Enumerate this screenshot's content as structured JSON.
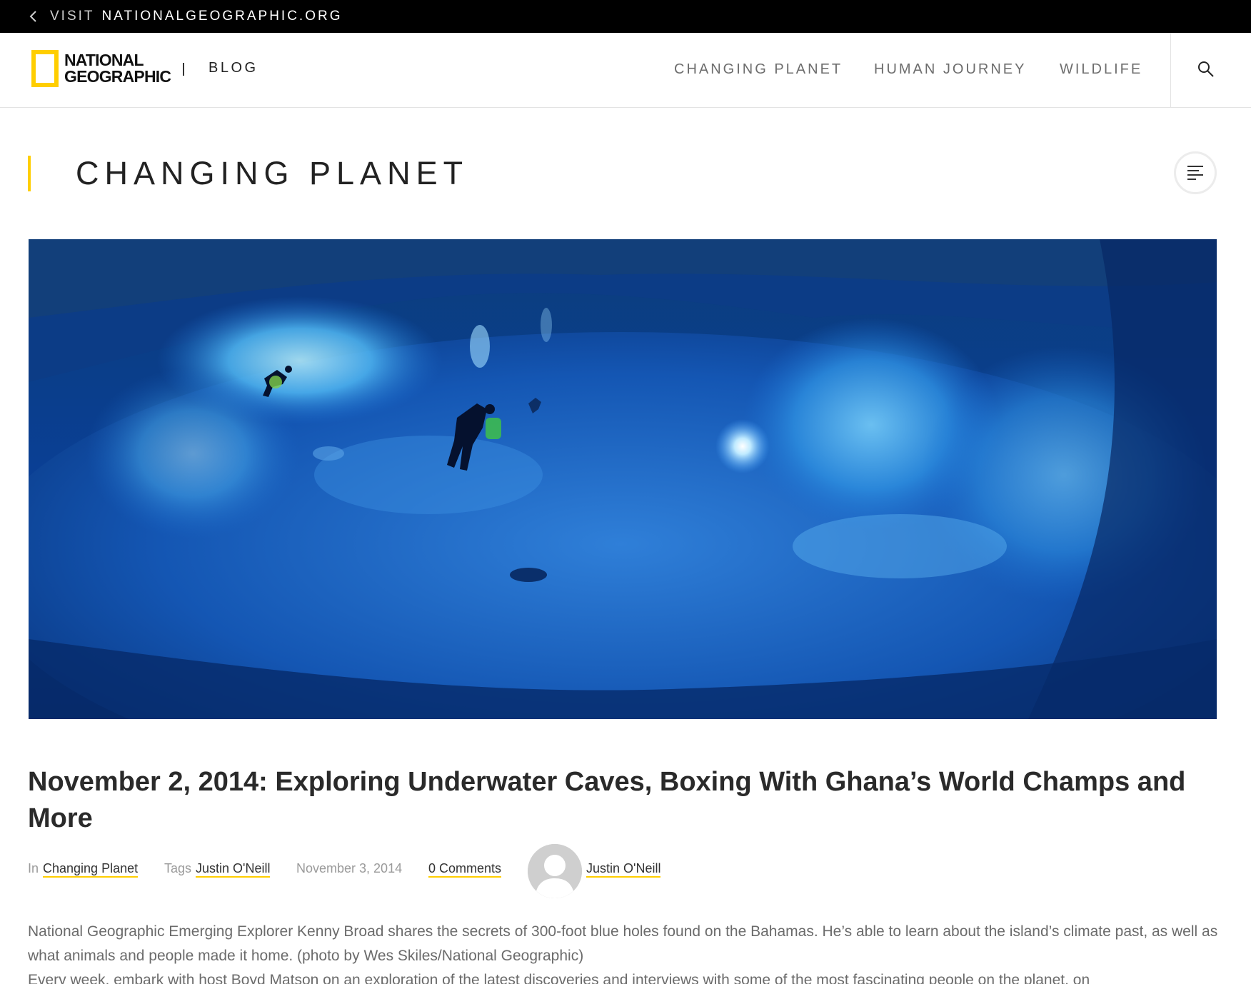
{
  "topbar": {
    "visit": "VISIT",
    "site": "NATIONALGEOGRAPHIC.ORG"
  },
  "header": {
    "logo_line1": "NATIONAL",
    "logo_line2": "GEOGRAPHIC",
    "blog": "BLOG",
    "nav": [
      "CHANGING PLANET",
      "HUMAN JOURNEY",
      "WILDLIFE"
    ],
    "icons": {
      "back": "chevron-left-icon",
      "search": "search-icon",
      "menu": "menu-icon"
    }
  },
  "section": {
    "title": "CHANGING PLANET"
  },
  "colors": {
    "accent": "#ffce00",
    "topbar": "#000000",
    "nav_text": "#6d6d6d"
  },
  "article": {
    "title": "November 2, 2014: Exploring Underwater Caves, Boxing With Ghana’s World Champs and More",
    "meta": {
      "in_label": "In",
      "category": "Changing Planet",
      "tags_label": "Tags",
      "tag": "Justin O'Neill",
      "date": "November 3, 2014",
      "comments": "0 Comments",
      "author": "Justin O'Neill"
    },
    "paragraph1": "National Geographic Emerging Explorer Kenny Broad shares the secrets of 300-foot blue holes found on the Bahamas. He’s able to learn about the island’s climate past, as well as what animals and people made it home. (photo by Wes Skiles/National Geographic)",
    "paragraph2": "Every week, embark with host Boyd Matson on an exploration of the latest discoveries and interviews with some of the most fascinating people on the planet, on"
  }
}
